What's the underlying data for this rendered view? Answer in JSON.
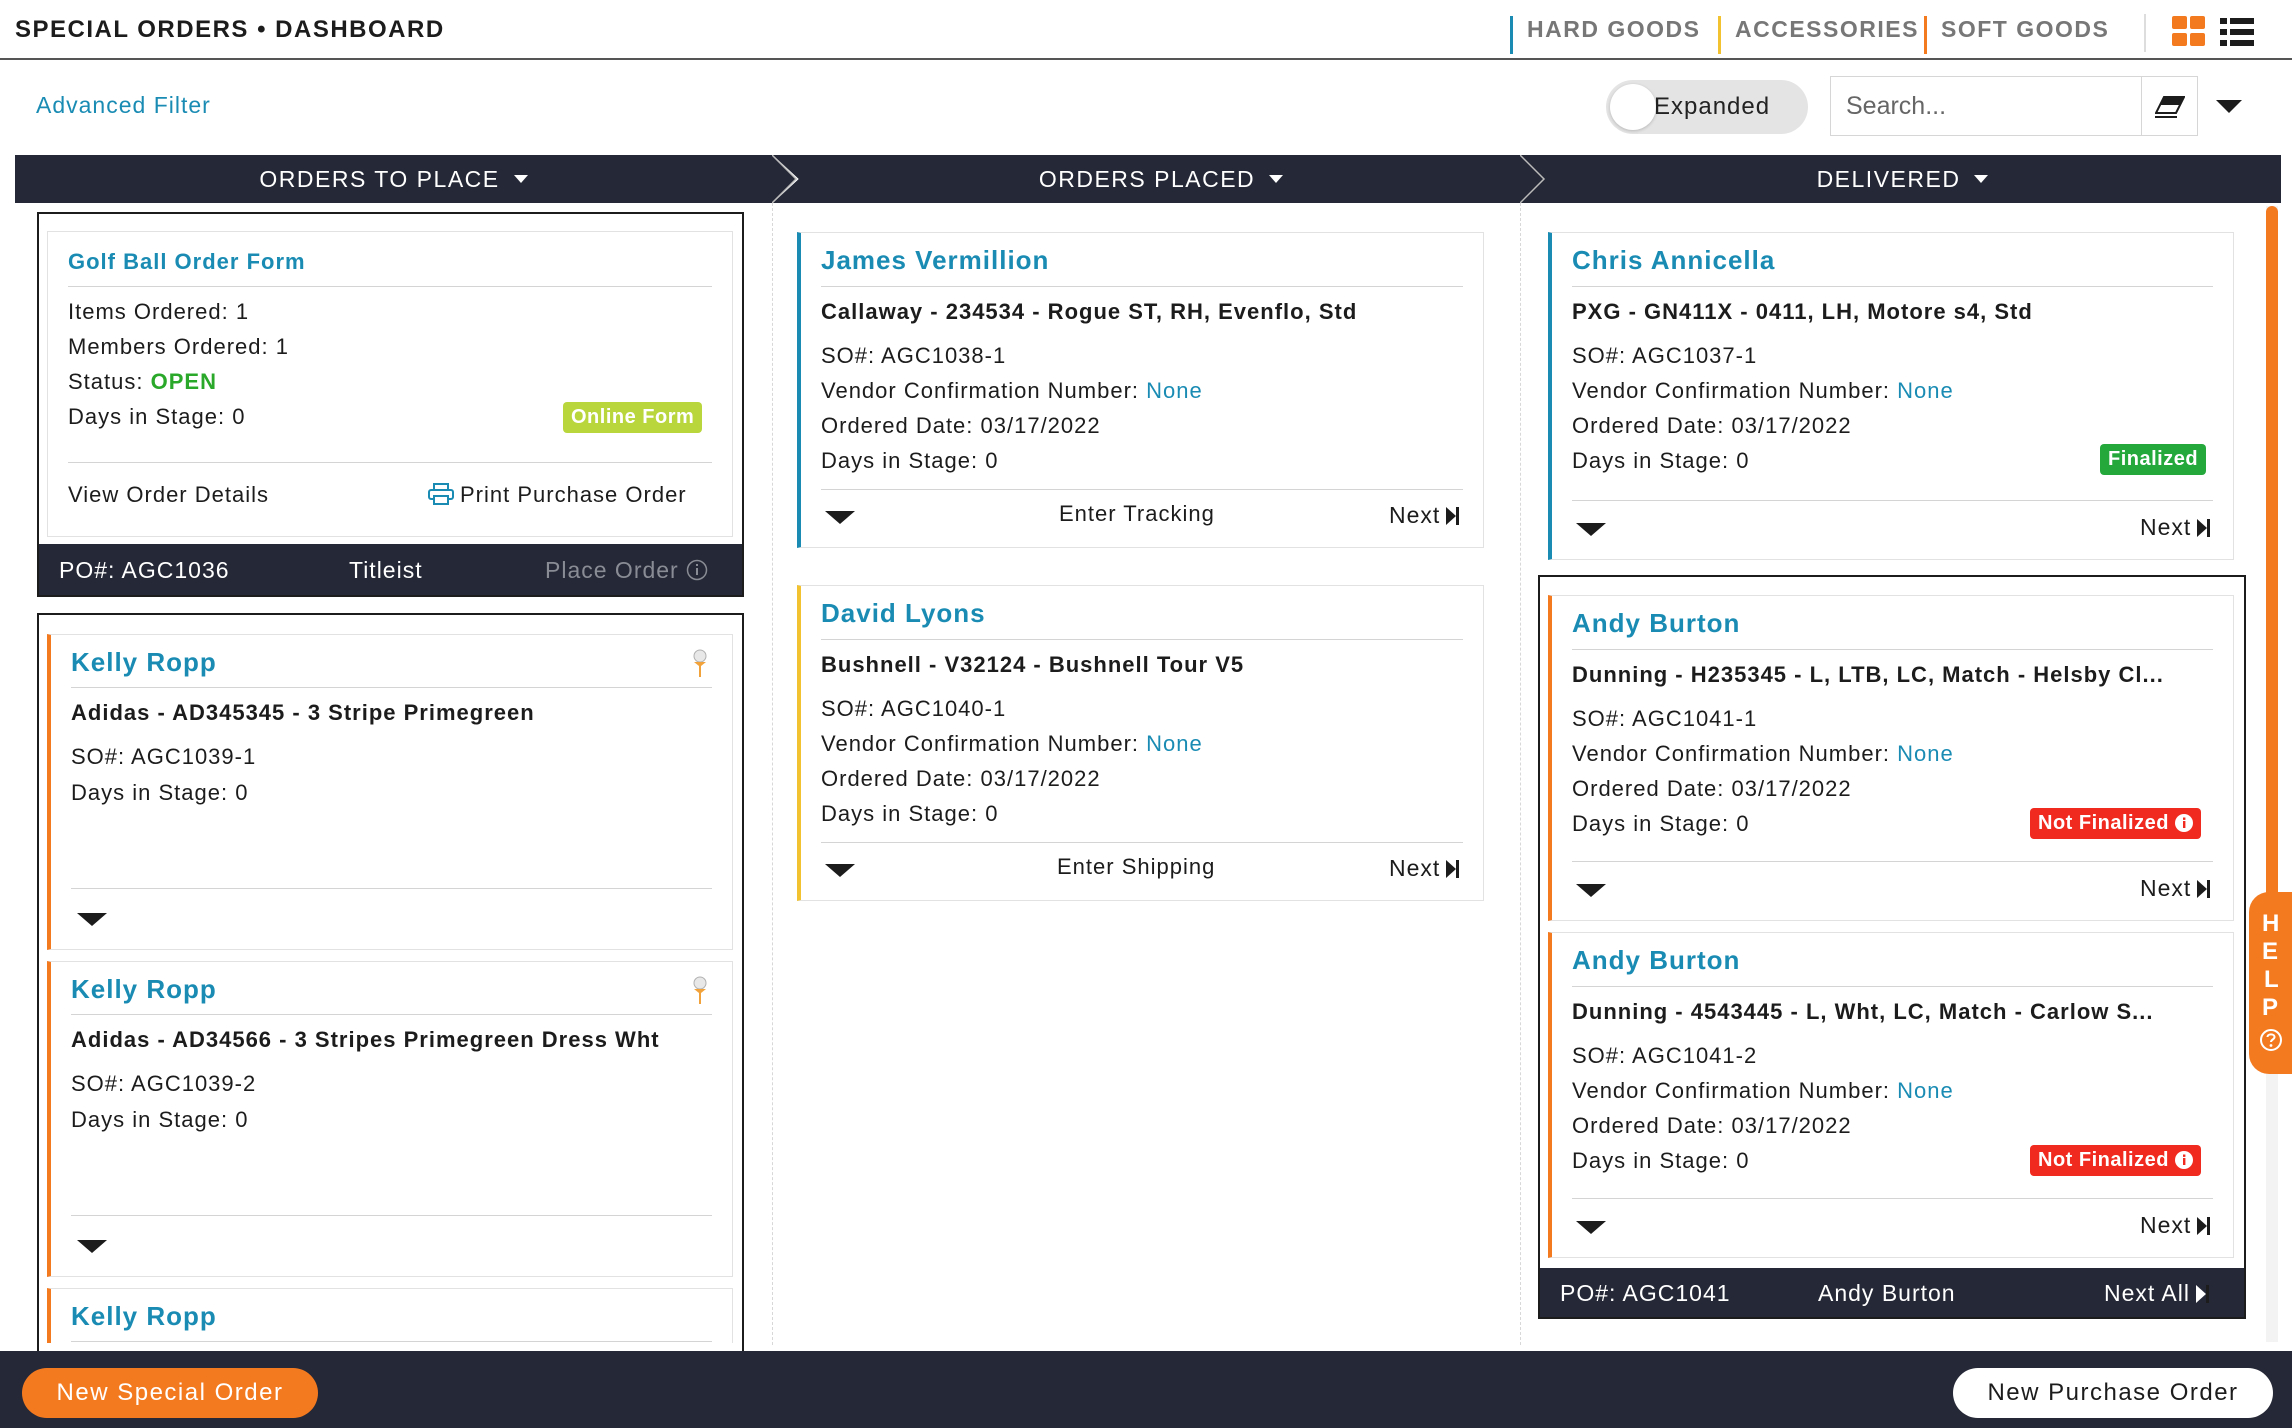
{
  "header": {
    "title": "SPECIAL ORDERS • DASHBOARD",
    "categories": [
      "HARD GOODS",
      "ACCESSORIES",
      "SOFT GOODS"
    ],
    "category_colors": [
      "#1a8cb4",
      "#f2c230",
      "#f47a20"
    ]
  },
  "toolbar": {
    "advanced_filter": "Advanced Filter",
    "toggle_label": "Expanded",
    "search_placeholder": "Search...",
    "icons": [
      "eraser-icon",
      "chevron-down-icon",
      "grid-view-icon",
      "list-view-icon"
    ]
  },
  "columns": [
    {
      "label": "ORDERS TO PLACE"
    },
    {
      "label": "ORDERS PLACED"
    },
    {
      "label": "DELIVERED"
    }
  ],
  "to_place": {
    "form_card": {
      "title": "Golf Ball Order Form",
      "items_ordered": "Items Ordered: 1",
      "members_ordered": "Members Ordered: 1",
      "status_label": "Status:",
      "status_value": "OPEN",
      "days": "Days in Stage: 0",
      "badge": "Online Form",
      "view_details": "View Order Details",
      "print_po": "Print Purchase Order"
    },
    "form_po_bar": {
      "po": "PO#: AGC1036",
      "vendor": "Titleist",
      "action": "Place Order"
    },
    "cards": [
      {
        "name": "Kelly Ropp",
        "product": "Adidas - AD345345 - 3 Stripe Primegreen",
        "so": "SO#: AGC1039-1",
        "days": "Days in Stage: 0"
      },
      {
        "name": "Kelly Ropp",
        "product": "Adidas - AD34566 - 3 Stripes Primegreen Dress Wht",
        "so": "SO#: AGC1039-2",
        "days": "Days in Stage: 0"
      },
      {
        "name": "Kelly Ropp"
      }
    ]
  },
  "placed": {
    "cards": [
      {
        "name": "James Vermillion",
        "product": "Callaway - 234534 - Rogue ST, RH, Evenflo, Std",
        "so": "SO#: AGC1038-1",
        "vcn_label": "Vendor Confirmation Number:",
        "vcn_value": "None",
        "ordered": "Ordered Date: 03/17/2022",
        "days": "Days in Stage: 0",
        "action": "Enter Tracking",
        "next": "Next"
      },
      {
        "name": "David Lyons",
        "product": "Bushnell - V32124 - Bushnell Tour V5",
        "so": "SO#: AGC1040-1",
        "vcn_label": "Vendor Confirmation Number:",
        "vcn_value": "None",
        "ordered": "Ordered Date: 03/17/2022",
        "days": "Days in Stage: 0",
        "action": "Enter Shipping",
        "next": "Next"
      }
    ]
  },
  "delivered": {
    "cards": [
      {
        "name": "Chris Annicella",
        "product": "PXG - GN411X - 0411, LH, Motore s4, Std",
        "so": "SO#: AGC1037-1",
        "vcn_label": "Vendor Confirmation Number:",
        "vcn_value": "None",
        "ordered": "Ordered Date: 03/17/2022",
        "days": "Days in Stage: 0",
        "badge": "Finalized",
        "next": "Next"
      },
      {
        "name": "Andy Burton",
        "product": "Dunning - H235345 - L, LTB, LC, Match - Helsby Cl...",
        "so": "SO#: AGC1041-1",
        "vcn_label": "Vendor Confirmation Number:",
        "vcn_value": "None",
        "ordered": "Ordered Date: 03/17/2022",
        "days": "Days in Stage: 0",
        "badge": "Not Finalized",
        "next": "Next"
      },
      {
        "name": "Andy Burton",
        "product": "Dunning - 4543445 - L, Wht, LC, Match - Carlow S...",
        "so": "SO#: AGC1041-2",
        "vcn_label": "Vendor Confirmation Number:",
        "vcn_value": "None",
        "ordered": "Ordered Date: 03/17/2022",
        "days": "Days in Stage: 0",
        "badge": "Not Finalized",
        "next": "Next"
      }
    ],
    "group_bar": {
      "po": "PO#: AGC1041",
      "member": "Andy Burton",
      "action": "Next All"
    }
  },
  "help": {
    "letters": [
      "H",
      "E",
      "L",
      "P"
    ]
  },
  "footer": {
    "new_special_order": "New Special Order",
    "new_purchase_order": "New Purchase Order"
  },
  "colors": {
    "accent": "#1a8cb4",
    "orange": "#f47a20",
    "dark": "#252836",
    "status_open": "#2aa82a",
    "online_form": "#b9d63c",
    "finalized": "#24a83c",
    "not_finalized": "#f02a1e"
  }
}
